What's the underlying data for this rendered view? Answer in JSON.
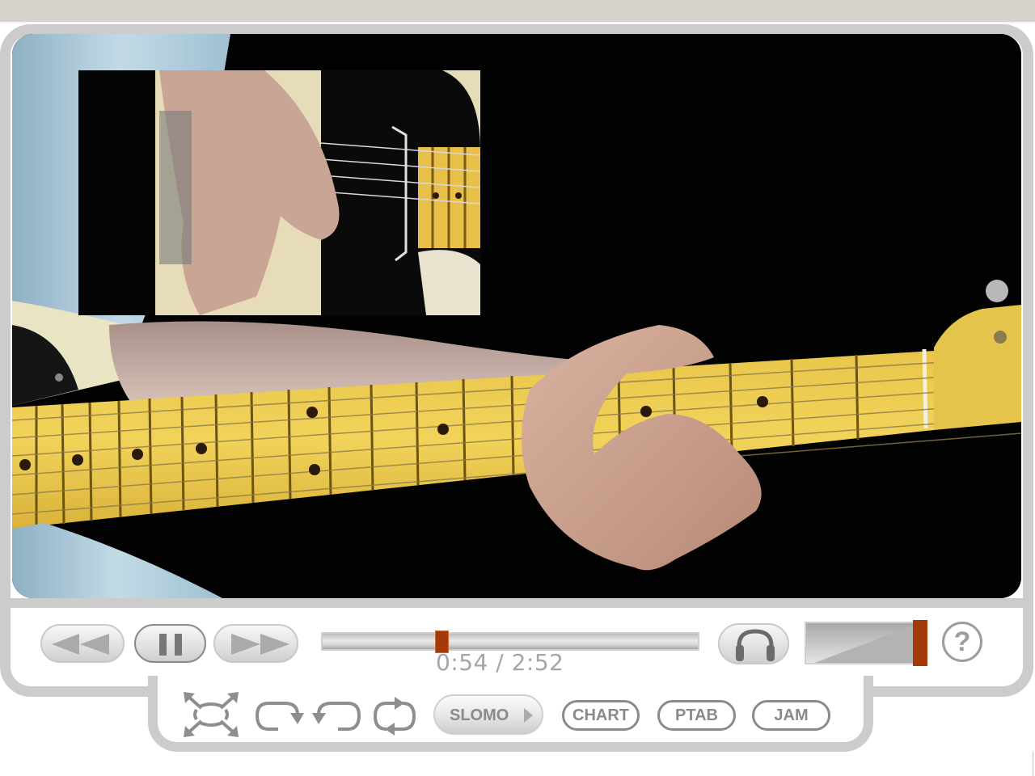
{
  "player": {
    "video": {
      "description": "Guitar lesson video: main view of fretting hand on maple-neck electric guitar with inset close-up of picking hand",
      "inset": "picking-hand close-up"
    },
    "controls": {
      "rewind": {
        "icon": "rewind-icon",
        "label": "Rewind"
      },
      "pause": {
        "icon": "pause-icon",
        "label": "Pause",
        "active": true
      },
      "fast_forward": {
        "icon": "fast-forward-icon",
        "label": "Fast forward"
      },
      "progress": {
        "current": "0:54",
        "total": "2:52",
        "fraction": 0.314
      },
      "time_display": "0:54 / 2:52",
      "audio": {
        "icon": "headphones-icon",
        "label": "Audio"
      },
      "volume": {
        "level": 1.0
      },
      "help": {
        "label": "?",
        "icon": "help-icon"
      }
    },
    "toolbar": {
      "fullscreen": {
        "icon": "fullscreen-icon"
      },
      "loop_forward": {
        "icon": "loop-forward-icon"
      },
      "loop_back": {
        "icon": "loop-back-icon"
      },
      "loop_repeat": {
        "icon": "repeat-icon"
      },
      "slomo_label": "SLOMO",
      "chart_label": "CHART",
      "ptab_label": "PTAB",
      "jam_label": "JAM"
    }
  },
  "colors": {
    "frame": "#cccccc",
    "accent": "#a33a0a",
    "icon_gray": "#8a8a8a",
    "topbar": "#d6d3cc"
  }
}
